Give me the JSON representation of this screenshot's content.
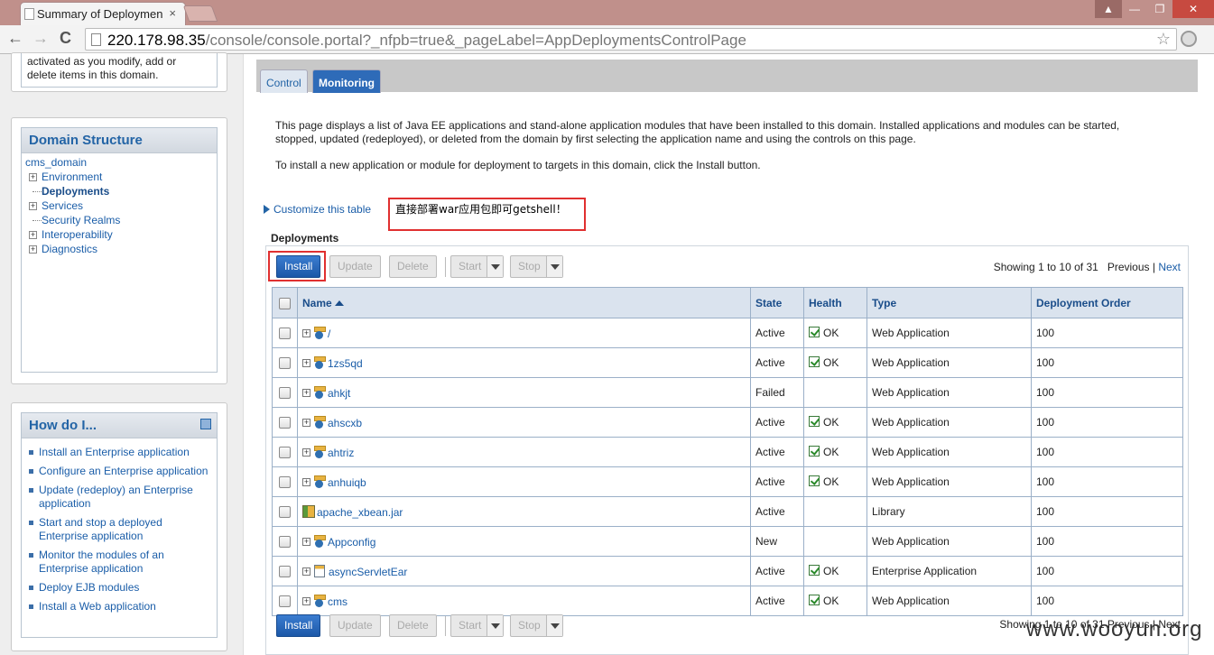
{
  "browser": {
    "tab_title": "Summary of Deploymen",
    "close_glyph": "×",
    "url_host": "220.178.98.35",
    "url_rest": "/console/console.portal?_nfpb=true&_pageLabel=AppDeploymentsControlPage",
    "back_glyph": "←",
    "forward_glyph": "→",
    "reload_glyph": "C",
    "star_glyph": "☆",
    "min_glyph": "—",
    "max_glyph": "❐",
    "user_glyph": "▲",
    "winclose_glyph": "✕"
  },
  "sidebar": {
    "change_text_1": "activated as you modify, add or",
    "change_text_2": "delete items in this domain.",
    "domain_structure": {
      "title": "Domain Structure",
      "root": "cms_domain",
      "items": [
        {
          "label": "Environment",
          "expandable": true
        },
        {
          "label": "Deployments",
          "expandable": false
        },
        {
          "label": "Services",
          "expandable": true
        },
        {
          "label": "Security Realms",
          "expandable": false
        },
        {
          "label": "Interoperability",
          "expandable": true
        },
        {
          "label": "Diagnostics",
          "expandable": true
        }
      ]
    },
    "how_do_i": {
      "title": "How do I...",
      "links": [
        "Install an Enterprise application",
        "Configure an Enterprise application",
        "Update (redeploy) an Enterprise application",
        "Start and stop a deployed Enterprise application",
        "Monitor the modules of an Enterprise application",
        "Deploy EJB modules",
        "Install a Web application"
      ]
    }
  },
  "main": {
    "tabs": {
      "control": "Control",
      "monitoring": "Monitoring"
    },
    "desc_1": "This page displays a list of Java EE applications and stand-alone application modules that have been installed to this domain. Installed applications and modules can be started, stopped, updated (redeployed), or deleted from the domain by first selecting the application name and using the controls on this page.",
    "desc_2": "To install a new application or module for deployment to targets in this domain, click the Install button.",
    "customize": "Customize this table",
    "annotation": "直接部署war应用包即可getshell！",
    "deployments_title": "Deployments",
    "buttons": {
      "install": "Install",
      "update": "Update",
      "delete": "Delete",
      "start": "Start",
      "stop": "Stop"
    },
    "paging": {
      "showing": "Showing 1 to 10 of 31",
      "previous": "Previous",
      "sep": "|",
      "next": "Next"
    },
    "columns": {
      "name": "Name",
      "state": "State",
      "health": "Health",
      "type": "Type",
      "order": "Deployment Order"
    },
    "rows": [
      {
        "name": "/",
        "state": "Active",
        "health": "OK",
        "type": "Web Application",
        "order": "100",
        "icon": "web-app-icon",
        "expand": true
      },
      {
        "name": "1zs5qd",
        "state": "Active",
        "health": "OK",
        "type": "Web Application",
        "order": "100",
        "icon": "web-app-icon",
        "expand": true
      },
      {
        "name": "ahkjt",
        "state": "Failed",
        "health": "",
        "type": "Web Application",
        "order": "100",
        "icon": "web-app-icon",
        "expand": true
      },
      {
        "name": "ahscxb",
        "state": "Active",
        "health": "OK",
        "type": "Web Application",
        "order": "100",
        "icon": "web-app-icon",
        "expand": true
      },
      {
        "name": "ahtriz",
        "state": "Active",
        "health": "OK",
        "type": "Web Application",
        "order": "100",
        "icon": "web-app-icon",
        "expand": true
      },
      {
        "name": "anhuiqb",
        "state": "Active",
        "health": "OK",
        "type": "Web Application",
        "order": "100",
        "icon": "web-app-icon",
        "expand": true
      },
      {
        "name": "apache_xbean.jar",
        "state": "Active",
        "health": "",
        "type": "Library",
        "order": "100",
        "icon": "library-icon",
        "expand": false
      },
      {
        "name": "Appconfig",
        "state": "New",
        "health": "",
        "type": "Web Application",
        "order": "100",
        "icon": "web-app-icon",
        "expand": true
      },
      {
        "name": "asyncServletEar",
        "state": "Active",
        "health": "OK",
        "type": "Enterprise Application",
        "order": "100",
        "icon": "enterprise-app-icon",
        "expand": true
      },
      {
        "name": "cms",
        "state": "Active",
        "health": "OK",
        "type": "Web Application",
        "order": "100",
        "icon": "web-app-icon",
        "expand": true
      }
    ],
    "bottom_paging": "Showing 1 to 10 of 31   Previous | Next"
  },
  "watermark": "www.wooyun.org"
}
